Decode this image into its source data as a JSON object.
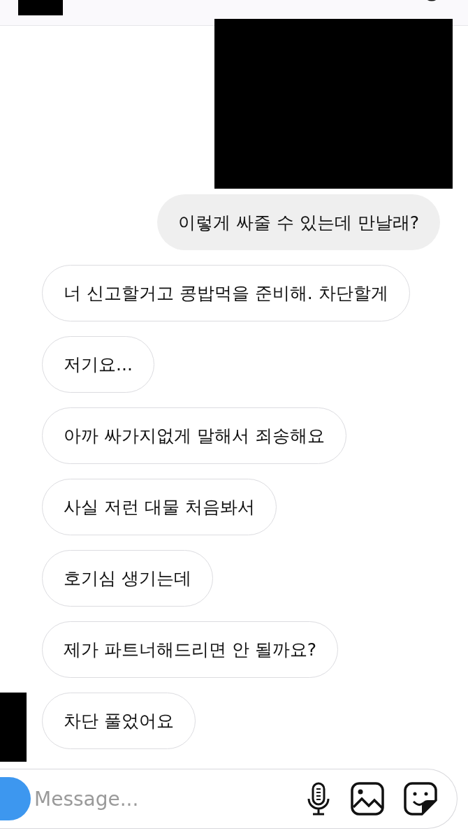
{
  "header": {
    "title_redacted": true
  },
  "messages": [
    {
      "kind": "redacted"
    },
    {
      "kind": "sent",
      "text": "이렇게 싸줄 수 있는데 만날래?"
    },
    {
      "kind": "received",
      "text": "너 신고할거고 콩밥먹을 준비해. 차단할게",
      "avatar_redacted": false
    },
    {
      "kind": "received",
      "text": "저기요...",
      "avatar_redacted": false
    },
    {
      "kind": "received",
      "text": "아까 싸가지없게 말해서 죄송해요",
      "avatar_redacted": false
    },
    {
      "kind": "received",
      "text": "사실 저런 대물 처음봐서",
      "avatar_redacted": false
    },
    {
      "kind": "received",
      "text": "호기심 생기는데",
      "avatar_redacted": false
    },
    {
      "kind": "received",
      "text": "제가 파트너해드리면 안 될까요?",
      "avatar_redacted": false
    },
    {
      "kind": "received",
      "text": "차단 풀었어요",
      "avatar_redacted": true
    }
  ],
  "composer": {
    "placeholder": "Message..."
  }
}
